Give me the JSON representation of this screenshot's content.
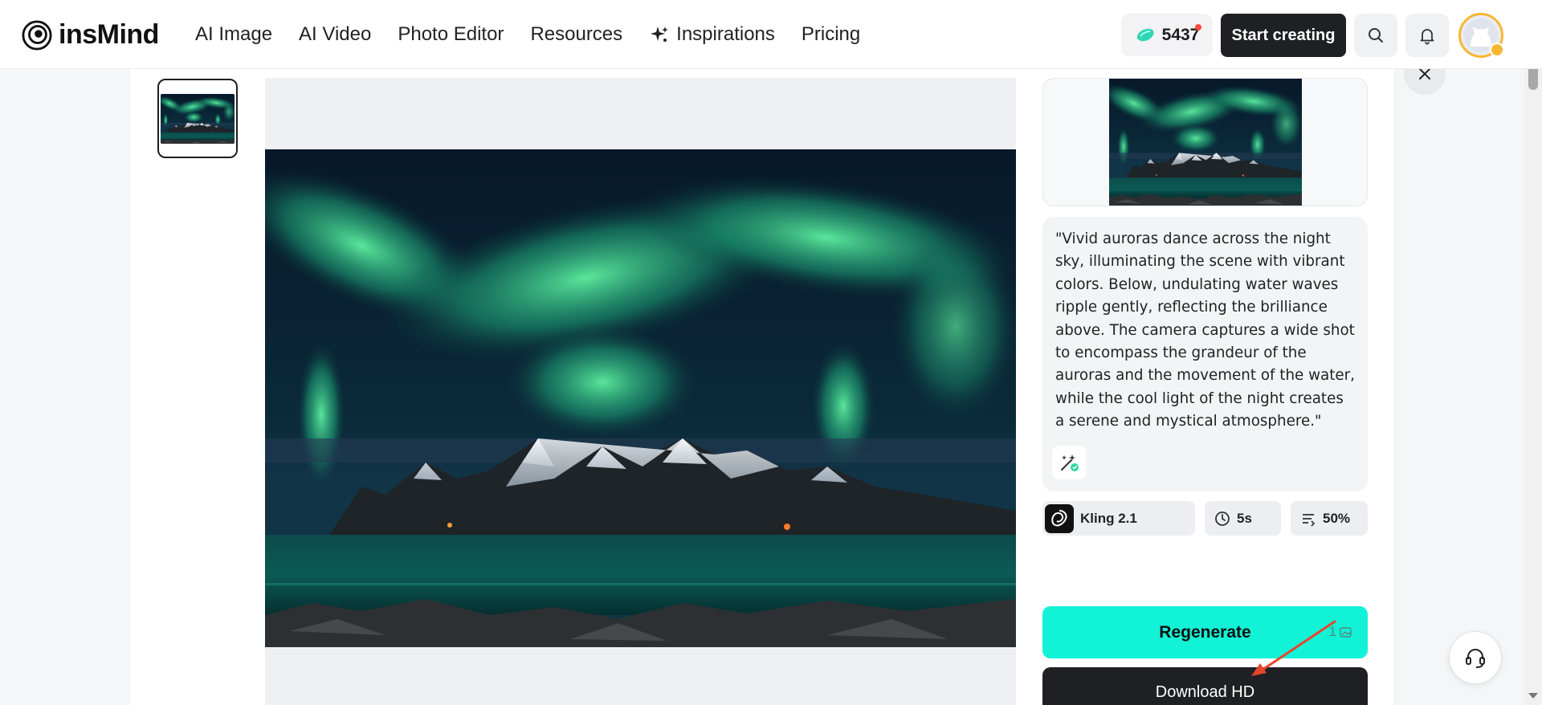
{
  "header": {
    "logo_text": "insMind",
    "nav": [
      {
        "label": "AI Image"
      },
      {
        "label": "AI Video"
      },
      {
        "label": "Photo Editor"
      },
      {
        "label": "Resources"
      },
      {
        "label": "Inspirations",
        "icon": "sparkle-icon"
      },
      {
        "label": "Pricing"
      }
    ],
    "credits": "5437",
    "start_button": "Start creating"
  },
  "prompt": {
    "text": "\"Vivid auroras dance across the night sky, illuminating the scene with vibrant colors. Below, undulating water waves ripple gently, reflecting the brilliance above. The camera captures a wide shot to encompass the grandeur of the auroras and the movement of the water, while the cool light of the night creates a serene and mystical atmosphere.\""
  },
  "chips": {
    "model": "Kling 2.1",
    "duration": "5s",
    "strength": "50%"
  },
  "actions": {
    "regenerate": "Regenerate",
    "regenerate_cost": "1",
    "download": "Download HD"
  },
  "colors": {
    "accent": "#12f2d6",
    "dark": "#1f2023",
    "annotation_arrow": "#e8452c"
  }
}
